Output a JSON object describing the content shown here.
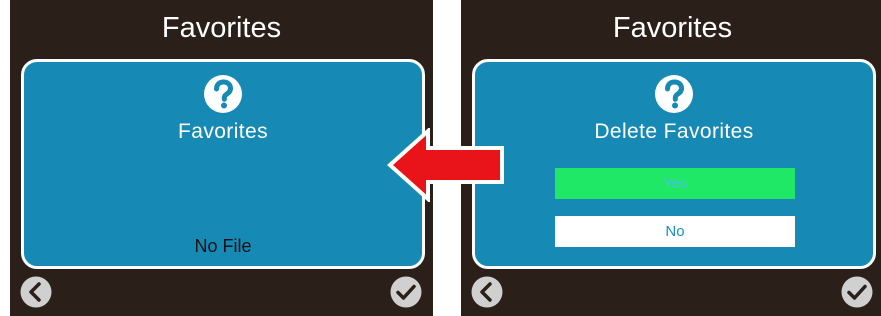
{
  "left_screen": {
    "title": "Favorites",
    "heading": "Favorites",
    "message": "No File"
  },
  "right_screen": {
    "title": "Favorites",
    "heading": "Delete Favorites",
    "options": [
      {
        "label": "Yes",
        "selected": true
      },
      {
        "label": "No",
        "selected": false
      }
    ]
  },
  "icons": {
    "help": "question-mark-icon",
    "back": "back-arrow-icon",
    "confirm": "checkmark-icon",
    "transition": "left-red-arrow-icon"
  },
  "colors": {
    "screen_background": "#2a1f19",
    "panel": "#168ab5",
    "selected_option": "#1ee866",
    "arrow": "#e8141a"
  }
}
